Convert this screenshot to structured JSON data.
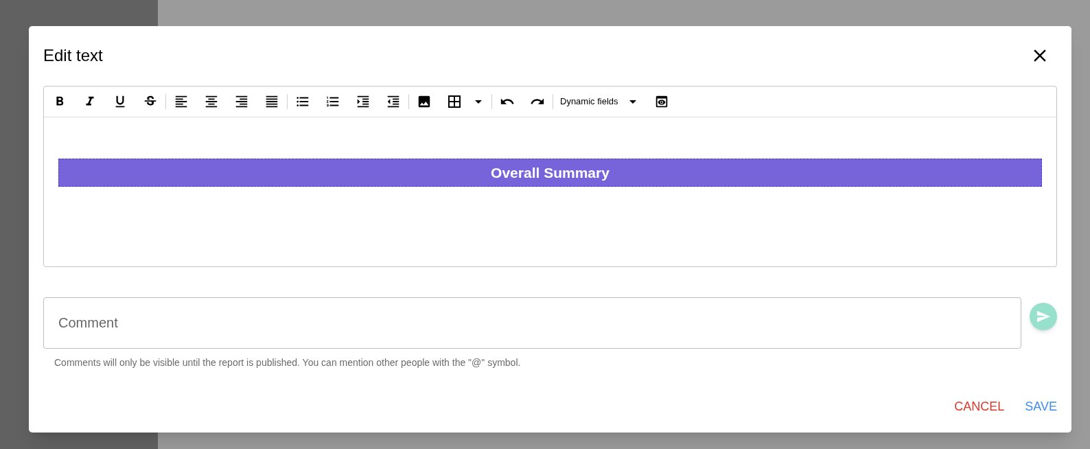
{
  "dialog": {
    "title": "Edit text"
  },
  "editor": {
    "toolbar": {
      "dynamic_fields": "Dynamic fields"
    },
    "banner": {
      "text": "Overall Summary",
      "color": "#7764db"
    }
  },
  "comment": {
    "placeholder": "Comment",
    "helper": "Comments will only be visible until the report is published. You can mention other people with the \"@\" symbol.",
    "send_disabled": true
  },
  "actions": [
    {
      "label": "CANCEL",
      "kind": "cancel"
    },
    {
      "label": "SAVE",
      "kind": "save"
    }
  ]
}
